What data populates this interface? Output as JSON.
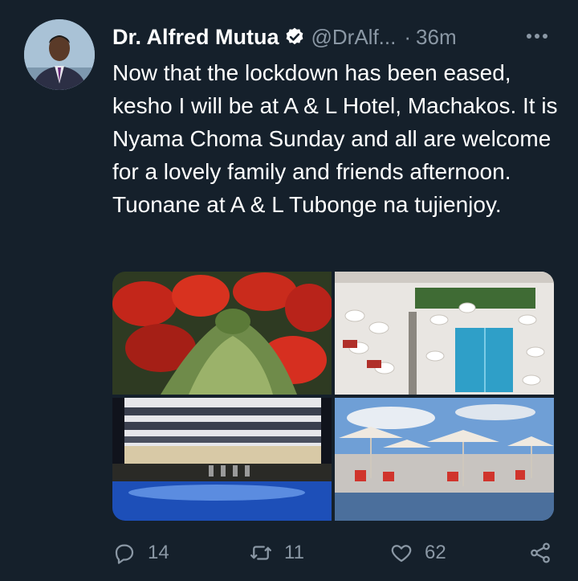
{
  "tweet": {
    "author_name": "Dr. Alfred Mutua",
    "handle": "@DrAlf...",
    "separator": "·",
    "time": "36m",
    "text": "Now that the lockdown has been eased, kesho I will be at A & L Hotel, Machakos. It is Nyama Choma Sunday and all are welcome for a lovely family and friends afternoon. Tuonane at A & L Tubonge na tujienjoy."
  },
  "media": {
    "images": [
      {
        "subject": "red-geraniums"
      },
      {
        "subject": "aerial-pool-terrace"
      },
      {
        "subject": "hotel-night-pool"
      },
      {
        "subject": "poolside-umbrellas"
      }
    ]
  },
  "actions": {
    "replies": "14",
    "retweets": "11",
    "likes": "62"
  },
  "icons": {
    "verified": "verified-badge-icon",
    "more": "more-options-icon",
    "reply": "reply-icon",
    "retweet": "retweet-icon",
    "like": "heart-icon",
    "share": "share-icon"
  },
  "colors": {
    "background": "#15202b",
    "text": "#ffffff",
    "secondary": "#8b98a5"
  }
}
